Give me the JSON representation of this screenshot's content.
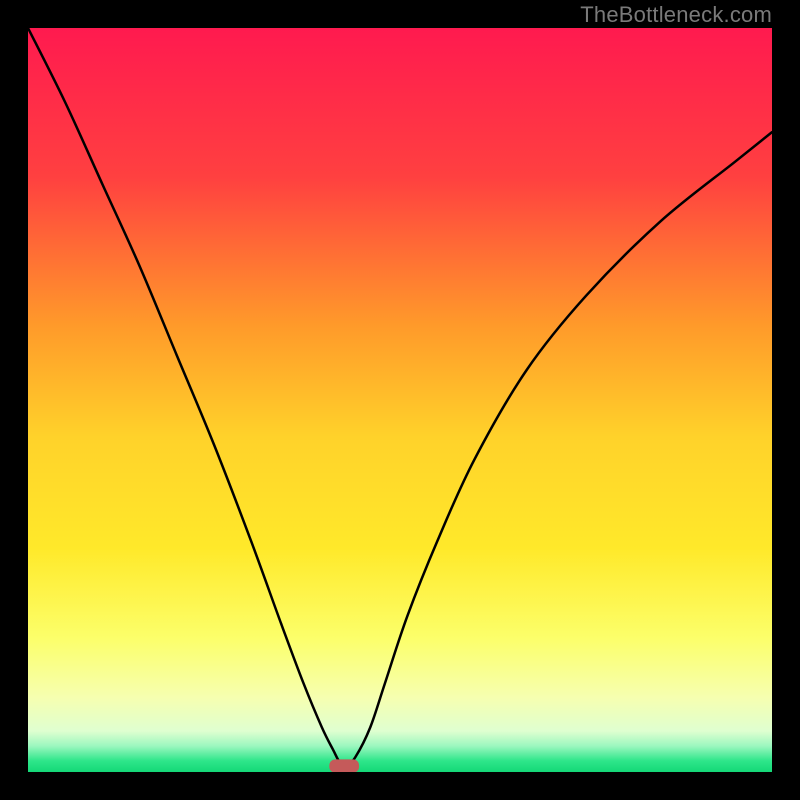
{
  "watermark": "TheBottleneck.com",
  "chart_data": {
    "type": "line",
    "title": "",
    "xlabel": "",
    "ylabel": "",
    "xlim": [
      0,
      100
    ],
    "ylim": [
      0,
      100
    ],
    "grid": false,
    "legend": false,
    "background": {
      "type": "vertical-gradient",
      "stops": [
        {
          "pos": 0.0,
          "color": "#ff1a4f"
        },
        {
          "pos": 0.2,
          "color": "#ff4040"
        },
        {
          "pos": 0.4,
          "color": "#ff9a2a"
        },
        {
          "pos": 0.55,
          "color": "#ffd22a"
        },
        {
          "pos": 0.7,
          "color": "#ffe92a"
        },
        {
          "pos": 0.82,
          "color": "#fcff6a"
        },
        {
          "pos": 0.9,
          "color": "#f6ffb0"
        },
        {
          "pos": 0.945,
          "color": "#dfffd0"
        },
        {
          "pos": 0.965,
          "color": "#9cf7bf"
        },
        {
          "pos": 0.985,
          "color": "#2ee68a"
        },
        {
          "pos": 1.0,
          "color": "#14d877"
        }
      ]
    },
    "series": [
      {
        "name": "bottleneck-curve",
        "x": [
          0,
          5,
          10,
          15,
          20,
          25,
          30,
          34,
          37,
          39.5,
          41,
          42,
          43,
          44,
          46,
          48,
          51,
          55,
          60,
          67,
          75,
          85,
          95,
          100
        ],
        "y": [
          100,
          90,
          79,
          68,
          56,
          44,
          31,
          20,
          12,
          6,
          3,
          1.2,
          1.2,
          2,
          6,
          12,
          21,
          31,
          42,
          54,
          64,
          74,
          82,
          86
        ]
      }
    ],
    "marker": {
      "name": "minimum-marker",
      "x": 42.5,
      "y": 0.8,
      "width": 4.0,
      "height": 1.8,
      "color": "#c55a5a"
    }
  }
}
